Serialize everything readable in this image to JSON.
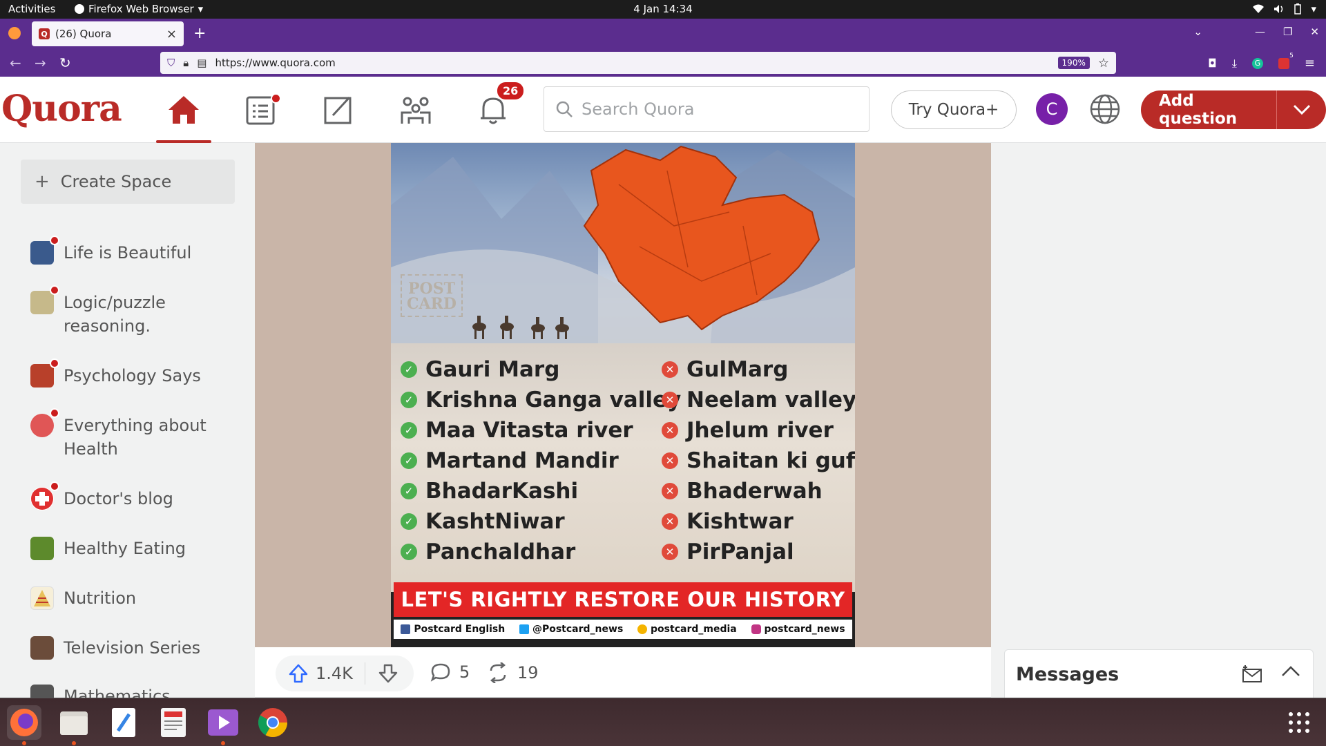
{
  "system": {
    "activities": "Activities",
    "app_menu": "Firefox Web Browser",
    "clock": "4 Jan  14:34"
  },
  "browser": {
    "tab_title": "(26) Quora",
    "url": "https://www.quora.com",
    "zoom": "190%",
    "extension_badge": "5"
  },
  "header": {
    "logo": "Quora",
    "notifications_count": "26",
    "search_placeholder": "Search Quora",
    "try_plus": "Try Quora+",
    "avatar_initial": "C",
    "add_question": "Add question"
  },
  "sidebar": {
    "create_space": "Create Space",
    "items": [
      {
        "label": "Life is Beautiful",
        "color": "#3a5a8c"
      },
      {
        "label": "Logic/puzzle reasoning.",
        "color": "#c6b98a"
      },
      {
        "label": "Psychology Says",
        "color": "#b8402a"
      },
      {
        "label": "Everything about Health",
        "color": "#e05656"
      },
      {
        "label": "Doctor's blog",
        "color": "#e03030"
      },
      {
        "label": "Healthy Eating",
        "color": "#5d8a2c"
      },
      {
        "label": "Nutrition",
        "color": "#e8c15a"
      },
      {
        "label": "Television Series",
        "color": "#6b4c3a"
      },
      {
        "label": "Mathematics",
        "color": "#555555"
      }
    ]
  },
  "post": {
    "stamp": "POST CARD",
    "left_names": [
      "Gauri Marg",
      "Krishna Ganga valley",
      "Maa Vitasta river",
      "Martand Mandir",
      "BhadarKashi",
      "KashtNiwar",
      "Panchaldhar"
    ],
    "right_names": [
      "GulMarg",
      "Neelam valley",
      "Jhelum river",
      "Shaitan ki gufa",
      "Bhaderwah",
      "Kishtwar",
      "PirPanjal"
    ],
    "banner": "LET'S RIGHTLY RESTORE OUR HISTORY",
    "social": [
      "Postcard English",
      "@Postcard_news",
      "postcard_media",
      "postcard_news"
    ],
    "upvotes": "1.4K",
    "comments": "5",
    "shares": "19"
  },
  "messages": {
    "title": "Messages"
  },
  "colors": {
    "quora_red": "#b92b27",
    "firefox_purple": "#5b2d8e",
    "avatar_purple": "#7720a8"
  }
}
